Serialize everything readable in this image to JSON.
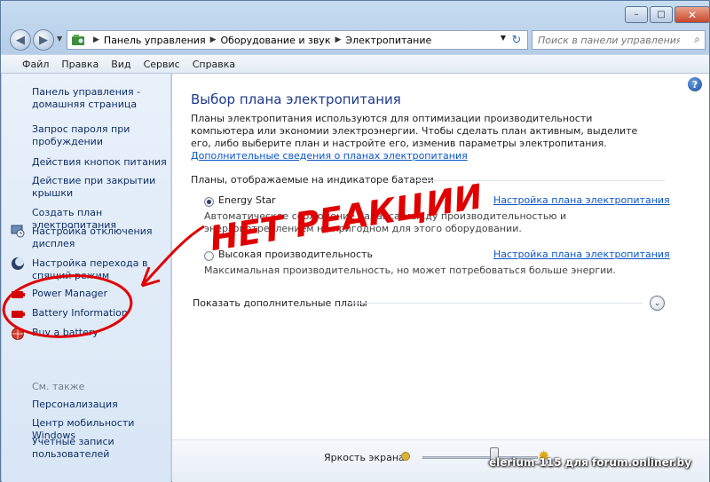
{
  "window": {
    "controls": {
      "minimize": "–",
      "maximize": "□",
      "close": "✕"
    }
  },
  "nav": {
    "breadcrumbs": [
      "Панель управления",
      "Оборудование и звук",
      "Электропитание"
    ],
    "search_placeholder": "Поиск в панели управления"
  },
  "menu": {
    "items": [
      "Файл",
      "Правка",
      "Вид",
      "Сервис",
      "Справка"
    ]
  },
  "sidebar": {
    "items": [
      {
        "label": "Панель управления - домашняя страница"
      },
      {
        "label": "Запрос пароля при пробуждении"
      },
      {
        "label": "Действия кнопок питания"
      },
      {
        "label": "Действие при закрытии крышки"
      },
      {
        "label": "Создать план электропитания"
      },
      {
        "label": "Настройка отключения дисплея",
        "icon": "clock-monitor-icon"
      },
      {
        "label": "Настройка перехода в спящий режим",
        "icon": "moon-icon"
      },
      {
        "label": "Power Manager",
        "icon": "battery-icon"
      },
      {
        "label": "Battery Information",
        "icon": "battery-icon"
      },
      {
        "label": "Buy a battery",
        "icon": "globe-icon"
      }
    ],
    "see_also_label": "См. также",
    "see_also": [
      {
        "label": "Персонализация"
      },
      {
        "label": "Центр мобильности Windows"
      },
      {
        "label": "Учетные записи пользователей"
      }
    ]
  },
  "main": {
    "title": "Выбор плана электропитания",
    "intro": "Планы электропитания используются для оптимизации производительности компьютера или экономии электроэнергии. Чтобы сделать план активным, выделите его, либо выберите план и настройте его, изменив параметры электропитания.",
    "intro_link": "Дополнительные сведения о планах электропитания",
    "group_label": "Планы, отображаемые на индикаторе батареи",
    "plans": [
      {
        "name": "Energy Star",
        "selected": true,
        "link": "Настройка плана электропитания",
        "description": "Автоматическое соблюдение баланса между производительностью и энергопотреблением на пригодном для этого оборудовании."
      },
      {
        "name": "Высокая производительность",
        "selected": false,
        "link": "Настройка плана электропитания",
        "description": "Максимальная производительность, но может потребоваться больше энергии."
      }
    ],
    "more_plans": "Показать дополнительные планы",
    "help": "?"
  },
  "footer": {
    "brightness_label": "Яркость экрана:",
    "brightness_level": 0.62
  },
  "annotation": {
    "text": "НЕТ РЕАКЦИИ",
    "color": "#e00000"
  },
  "watermark": "elerium-115 для forum.onliner.by"
}
